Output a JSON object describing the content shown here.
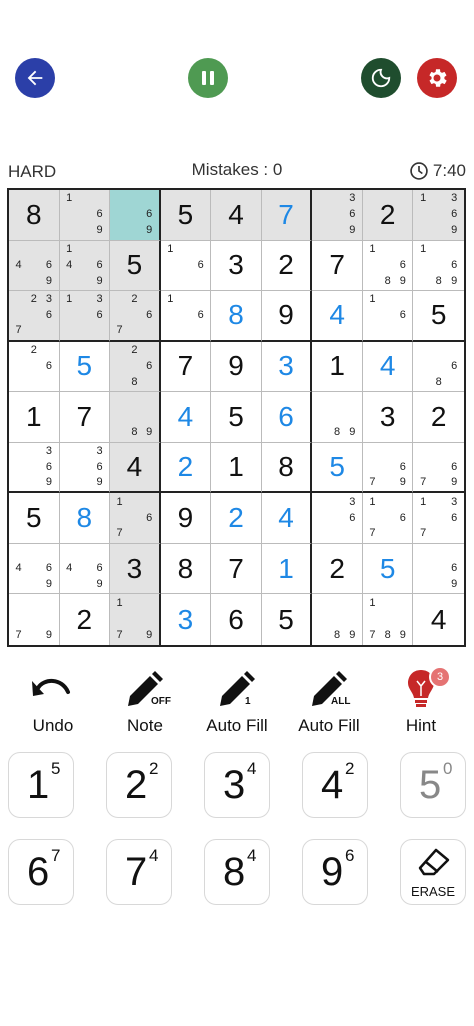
{
  "header": {
    "back_icon": "arrow-left-icon",
    "pause_icon": "pause-icon",
    "theme_icon": "moon-icon",
    "settings_icon": "gear-icon",
    "colors": {
      "back": "#2b3fa8",
      "pause": "#4f9a52",
      "theme": "#1f4d2e",
      "settings": "#c62828"
    }
  },
  "status": {
    "difficulty": "HARD",
    "mistakes": "Mistakes : 0",
    "timer": "7:40"
  },
  "board": {
    "selected": [
      0,
      2
    ],
    "highlight_color": "#e3e3e3",
    "selected_color": "#9fd6d4",
    "user_color": "#1e88e5",
    "rows": [
      [
        {
          "v": "8",
          "t": "g"
        },
        {
          "n": [
            1,
            6,
            9
          ]
        },
        {
          "n": [
            6,
            9
          ]
        },
        {
          "v": "5",
          "t": "g"
        },
        {
          "v": "4",
          "t": "g"
        },
        {
          "v": "7",
          "t": "u"
        },
        {
          "n": [
            3,
            6,
            9
          ]
        },
        {
          "v": "2",
          "t": "g"
        },
        {
          "n": [
            1,
            3,
            6,
            9
          ]
        }
      ],
      [
        {
          "n": [
            4,
            6,
            9
          ]
        },
        {
          "n": [
            1,
            4,
            6,
            9
          ]
        },
        {
          "v": "5",
          "t": "g"
        },
        {
          "n": [
            1,
            6
          ]
        },
        {
          "v": "3",
          "t": "g"
        },
        {
          "v": "2",
          "t": "g"
        },
        {
          "v": "7",
          "t": "g"
        },
        {
          "n": [
            1,
            6,
            8,
            9
          ]
        },
        {
          "n": [
            1,
            6,
            8,
            9
          ]
        }
      ],
      [
        {
          "n": [
            2,
            3,
            6,
            7
          ]
        },
        {
          "n": [
            1,
            3,
            6
          ]
        },
        {
          "n": [
            2,
            6,
            7
          ]
        },
        {
          "n": [
            1,
            6
          ]
        },
        {
          "v": "8",
          "t": "u"
        },
        {
          "v": "9",
          "t": "g"
        },
        {
          "v": "4",
          "t": "u"
        },
        {
          "n": [
            1,
            6
          ]
        },
        {
          "v": "5",
          "t": "g"
        }
      ],
      [
        {
          "n": [
            2,
            6
          ]
        },
        {
          "v": "5",
          "t": "u"
        },
        {
          "n": [
            2,
            6,
            8
          ]
        },
        {
          "v": "7",
          "t": "g"
        },
        {
          "v": "9",
          "t": "g"
        },
        {
          "v": "3",
          "t": "u"
        },
        {
          "v": "1",
          "t": "g"
        },
        {
          "v": "4",
          "t": "u"
        },
        {
          "n": [
            6,
            8
          ]
        }
      ],
      [
        {
          "v": "1",
          "t": "g"
        },
        {
          "v": "7",
          "t": "g"
        },
        {
          "n": [
            8,
            9
          ]
        },
        {
          "v": "4",
          "t": "u"
        },
        {
          "v": "5",
          "t": "g"
        },
        {
          "v": "6",
          "t": "u"
        },
        {
          "n": [
            8,
            9
          ]
        },
        {
          "v": "3",
          "t": "g"
        },
        {
          "v": "2",
          "t": "g"
        }
      ],
      [
        {
          "n": [
            3,
            6,
            9
          ]
        },
        {
          "n": [
            3,
            6,
            9
          ]
        },
        {
          "v": "4",
          "t": "g"
        },
        {
          "v": "2",
          "t": "u"
        },
        {
          "v": "1",
          "t": "g"
        },
        {
          "v": "8",
          "t": "g"
        },
        {
          "v": "5",
          "t": "u"
        },
        {
          "n": [
            6,
            7,
            9
          ]
        },
        {
          "n": [
            6,
            7,
            9
          ]
        }
      ],
      [
        {
          "v": "5",
          "t": "g"
        },
        {
          "v": "8",
          "t": "u"
        },
        {
          "n": [
            1,
            6,
            7
          ]
        },
        {
          "v": "9",
          "t": "g"
        },
        {
          "v": "2",
          "t": "u"
        },
        {
          "v": "4",
          "t": "u"
        },
        {
          "n": [
            3,
            6
          ]
        },
        {
          "n": [
            1,
            6,
            7
          ]
        },
        {
          "n": [
            1,
            3,
            6,
            7
          ]
        }
      ],
      [
        {
          "n": [
            4,
            6,
            9
          ]
        },
        {
          "n": [
            4,
            6,
            9
          ]
        },
        {
          "v": "3",
          "t": "g"
        },
        {
          "v": "8",
          "t": "g"
        },
        {
          "v": "7",
          "t": "g"
        },
        {
          "v": "1",
          "t": "u"
        },
        {
          "v": "2",
          "t": "g"
        },
        {
          "v": "5",
          "t": "u"
        },
        {
          "n": [
            6,
            9
          ]
        }
      ],
      [
        {
          "n": [
            7,
            9
          ]
        },
        {
          "v": "2",
          "t": "g"
        },
        {
          "n": [
            1,
            7,
            9
          ]
        },
        {
          "v": "3",
          "t": "u"
        },
        {
          "v": "6",
          "t": "g"
        },
        {
          "v": "5",
          "t": "g"
        },
        {
          "n": [
            8,
            9
          ]
        },
        {
          "n": [
            1,
            7,
            8,
            9
          ]
        },
        {
          "v": "4",
          "t": "g"
        }
      ]
    ]
  },
  "tools": [
    {
      "name": "undo",
      "label": "Undo",
      "icon": "undo-icon"
    },
    {
      "name": "note",
      "label": "Note",
      "icon": "pencil-icon",
      "sub": "OFF"
    },
    {
      "name": "auto-fill-one",
      "label": "Auto Fill",
      "icon": "pencil-icon",
      "sub": "1"
    },
    {
      "name": "auto-fill-all",
      "label": "Auto Fill",
      "icon": "pencil-icon",
      "sub": "ALL"
    },
    {
      "name": "hint",
      "label": "Hint",
      "icon": "lightbulb-icon",
      "badge": "3"
    }
  ],
  "numpad": [
    {
      "digit": "1",
      "count": "5"
    },
    {
      "digit": "2",
      "count": "2"
    },
    {
      "digit": "3",
      "count": "4"
    },
    {
      "digit": "4",
      "count": "2"
    },
    {
      "digit": "5",
      "count": "0",
      "used": true
    },
    {
      "digit": "6",
      "count": "7"
    },
    {
      "digit": "7",
      "count": "4"
    },
    {
      "digit": "8",
      "count": "4"
    },
    {
      "digit": "9",
      "count": "6"
    },
    {
      "erase": true,
      "label": "ERASE",
      "icon": "eraser-icon"
    }
  ]
}
